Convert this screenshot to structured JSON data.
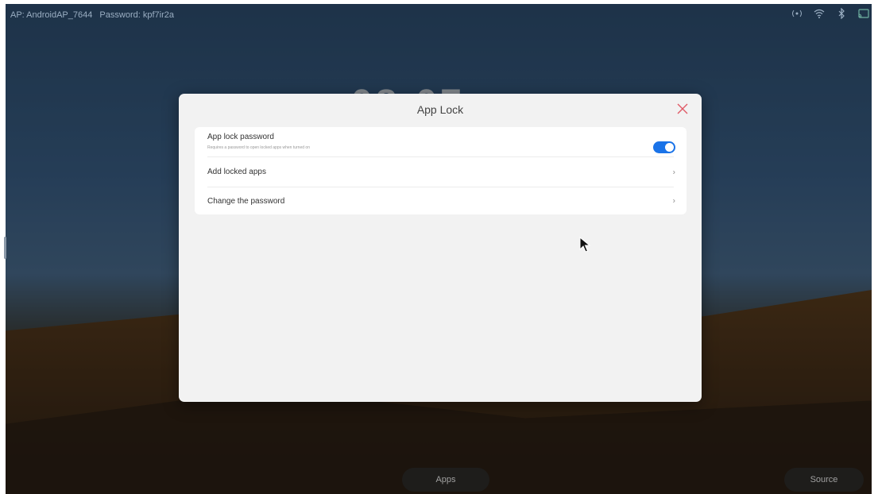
{
  "status_bar": {
    "ap": "AP: AndroidAP_7644",
    "password": "Password: kpf7ir2a",
    "icons": [
      "hotspot-icon",
      "wifi-icon",
      "bluetooth-icon",
      "cast-icon"
    ]
  },
  "dialog": {
    "title": "App Lock",
    "items": [
      {
        "title": "App lock password",
        "subtitle": "Requires a password to open locked apps when turned on",
        "toggle_on": true
      },
      {
        "title": "Add locked apps"
      },
      {
        "title": "Change the password"
      }
    ]
  },
  "dock": {
    "apps_label": "Apps",
    "source_label": "Source"
  },
  "colors": {
    "accent": "#1a73e8",
    "close": "#e05a66"
  }
}
